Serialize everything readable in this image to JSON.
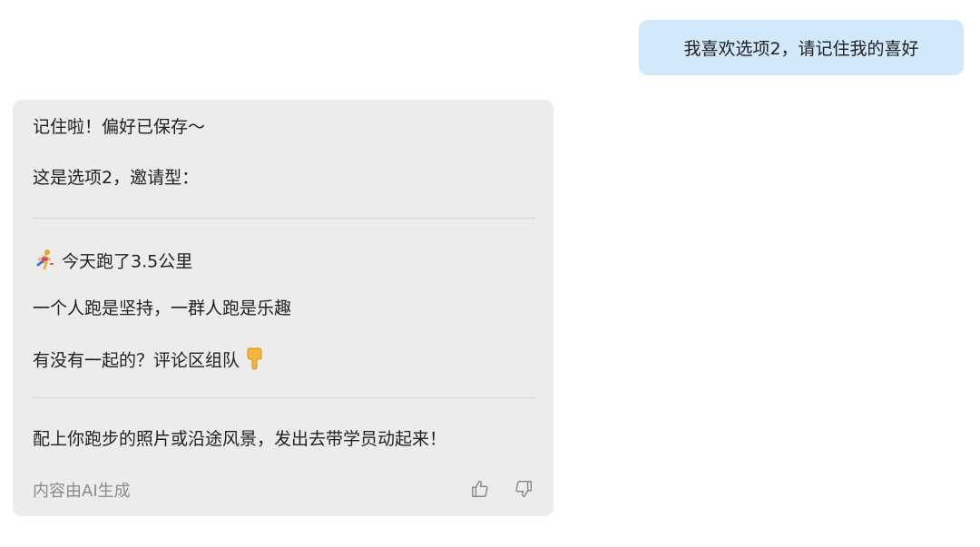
{
  "user_message": "我喜欢选项2，请记住我的喜好",
  "ai_message": {
    "confirmation": "记住啦！偏好已保存～",
    "intro": "这是选项2，邀请型：",
    "post_line1": "今天跑了3.5公里",
    "post_line2": "一个人跑是坚持，一群人跑是乐趣",
    "post_line3": "有没有一起的？评论区组队",
    "tip": "配上你跑步的照片或沿途风景，发出去带学员动起来！",
    "footer_note": "内容由AI生成"
  },
  "icons": {
    "runner": "runner-emoji",
    "pointing": "pointing-down-emoji",
    "like": "thumbs-up-icon",
    "dislike": "thumbs-down-icon"
  },
  "colors": {
    "user_bubble": "#d2e8fb",
    "ai_bubble": "#ececec",
    "muted_text": "#8a8a8a"
  }
}
